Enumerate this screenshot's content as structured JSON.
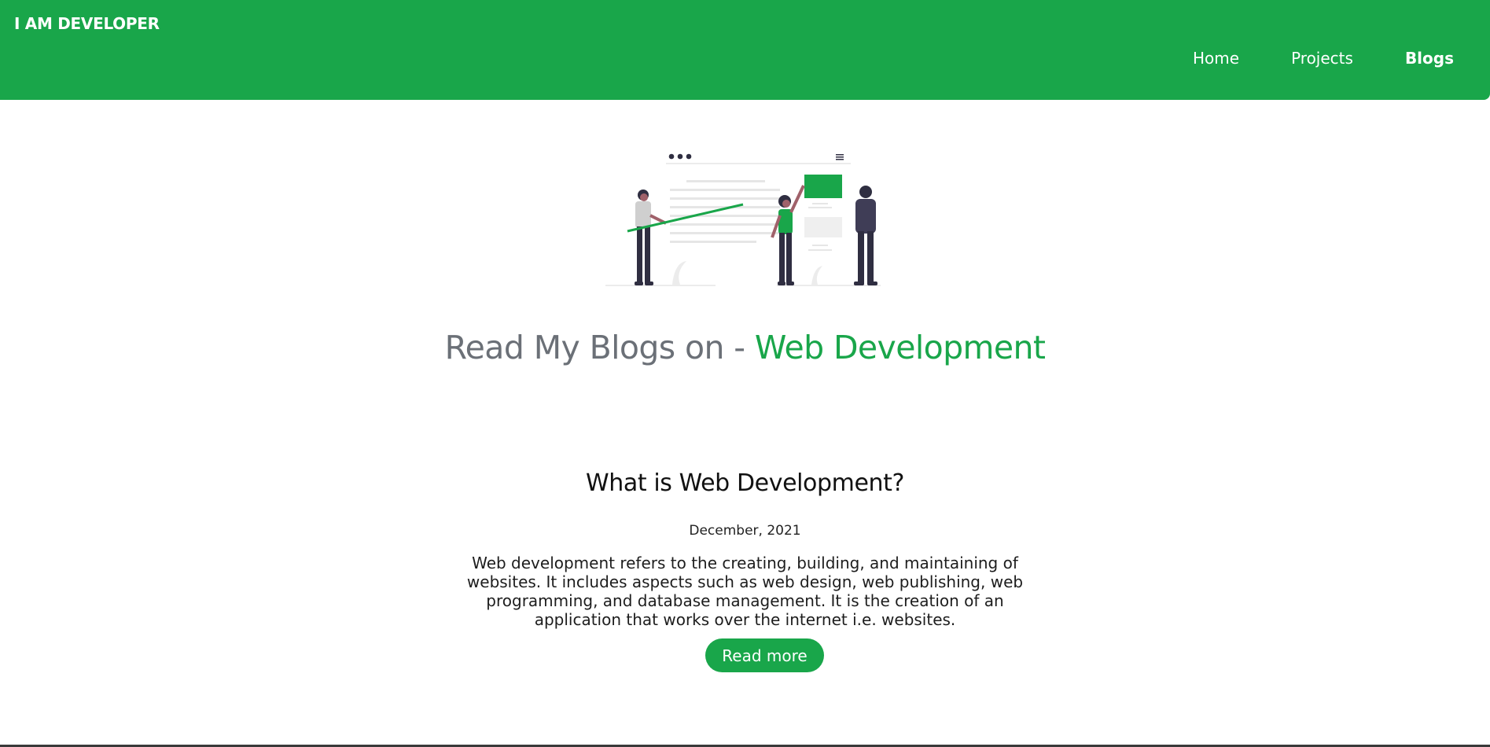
{
  "header": {
    "brand": "I AM DEVELOPER",
    "nav": [
      {
        "label": "Home",
        "active": false
      },
      {
        "label": "Projects",
        "active": false
      },
      {
        "label": "Blogs",
        "active": true
      }
    ]
  },
  "hero": {
    "title_prefix": "Read My Blogs on - ",
    "title_accent": "Web Development",
    "illustration_icon": "team-presentation-illustration"
  },
  "post": {
    "title": "What is Web Development?",
    "date": "December, 2021",
    "excerpt": "Web development refers to the creating, building, and maintaining of websites. It includes aspects such as web design, web publishing, web programming, and database management. It is the creation of an application that works over the internet i.e. websites.",
    "read_more_label": "Read more"
  },
  "colors": {
    "accent": "#19a64a",
    "muted_text": "#6b7077",
    "text": "#111111"
  }
}
